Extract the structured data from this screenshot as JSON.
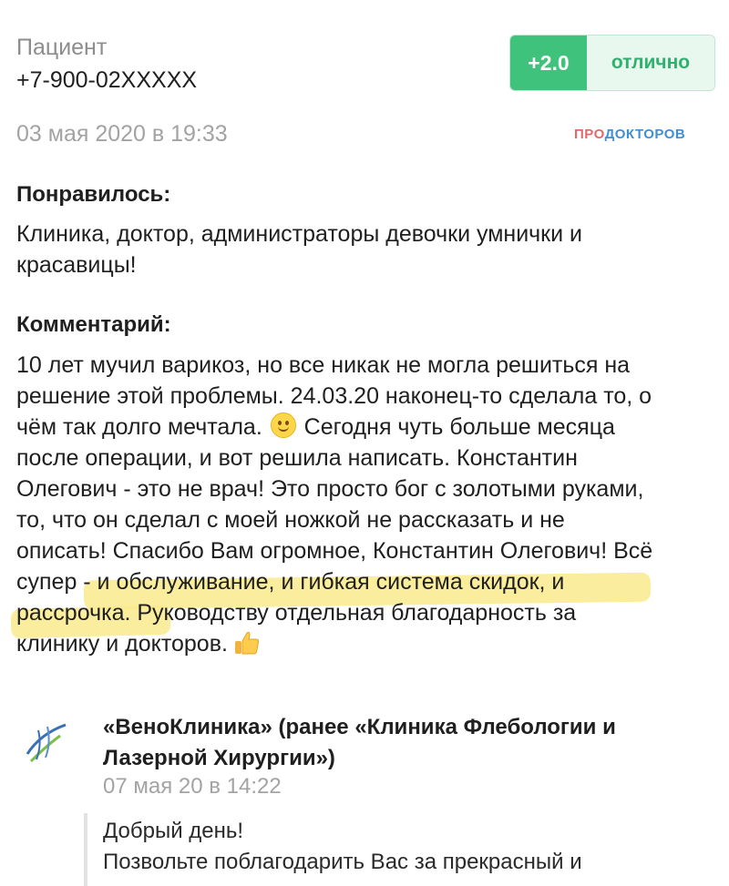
{
  "review": {
    "author_label": "Пациент",
    "author_phone": "+7-900-02XXXXX",
    "rating_score": "+2.0",
    "rating_word": "отлично",
    "date": "03 мая 2020 в 19:33",
    "brand_part1": "ПРО",
    "brand_part2": "ДОКТОРОВ",
    "liked_title": "Понравилось:",
    "liked_text": "Клиника, доктор, администраторы девочки умнички и красавицы!",
    "comment_title": "Комментарий:",
    "comment_lines": [
      "10 лет мучил варикоз, но все никак не могла решиться на",
      "решение этой проблемы. 24.03.20 наконец-то сделала то, о",
      "чём так долго мечтала.",
      " Сегодня чуть больше месяца",
      "после операции, и вот решила написать. Константин",
      "Олегович - это не врач! Это просто бог с золотыми руками,",
      "то, что он сделал с моей ножкой не рассказать и не",
      "описать! Спасибо Вам огромное, Константин Олегович! Всё",
      "супер - и обслуживание, и гибкая система скидок, и",
      "рассрочка. Руководству отдельная благодарность за",
      "клинику и докторов."
    ],
    "smile_emoji": "smiling-face-emoji",
    "thumbs_emoji": "thumbs-up-emoji",
    "highlight_color": "#f9ea8c"
  },
  "reply": {
    "clinic_name": "«ВеноКлиника» (ранее «Клиника Флебологии и Лазерной Хирургии»)",
    "date": "07 мая 20 в 14:22",
    "greeting": "Добрый день!",
    "text": "Позвольте поблагодарить Вас за прекрасный и"
  },
  "colors": {
    "accent_green": "#3ec27c",
    "muted_text": "#a3a3a3"
  }
}
